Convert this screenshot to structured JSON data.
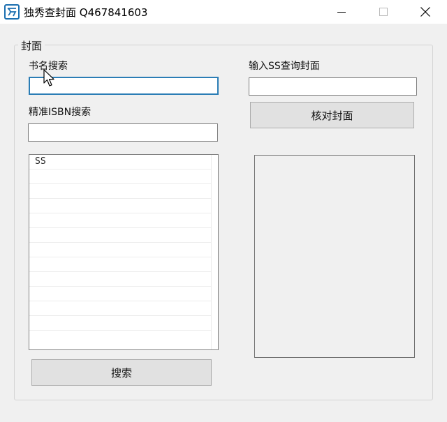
{
  "window": {
    "title": "独秀查封面 Q467841603",
    "icon": "app-logo-icon",
    "controls": [
      "minimize-icon",
      "maximize-icon",
      "close-icon"
    ]
  },
  "group": {
    "title": "封面"
  },
  "left": {
    "title_search_label": "书名搜索",
    "title_search_value": "",
    "isbn_search_label": "精准ISBN搜索",
    "isbn_search_value": "",
    "results": [
      "SS",
      "",
      "",
      "",
      "",
      "",
      "",
      "",
      "",
      "",
      "",
      ""
    ],
    "search_button": "搜索"
  },
  "right": {
    "ss_label": "输入SS查询封面",
    "ss_value": "",
    "check_button": "核对封面"
  },
  "colors": {
    "focus_border": "#2b7db5",
    "button_bg": "#e1e1e1",
    "window_bg": "#f0f0f0"
  }
}
